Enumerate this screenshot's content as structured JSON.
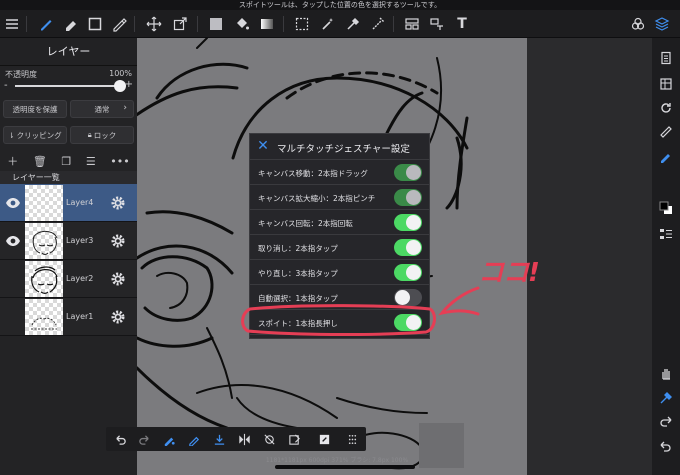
{
  "status_bar": {
    "message": "スポイトツールは、タップした位置の色を選択するツールです。"
  },
  "toolbar": {
    "icons": [
      "menu-icon",
      "brush-icon",
      "eraser-icon",
      "rectangle-icon",
      "pen-icon",
      "move-icon",
      "transform-icon",
      "color-fill-icon",
      "bucket-icon",
      "gradient-icon",
      "selection-icon",
      "magic-wand-icon",
      "eyedropper-icon",
      "lasso-icon",
      "layout-icon",
      "crop-icon",
      "text-icon",
      "materials-icon",
      "layers-icon"
    ],
    "text_icon_label": "T"
  },
  "layer_panel": {
    "title": "レイヤー",
    "opacity_label": "不透明度",
    "opacity_value": "100%",
    "opacity_fraction": 1.0,
    "minus_label": "-",
    "plus_label": "+",
    "protect_alpha_label": "透明度を保護",
    "blend_mode_label": "通常",
    "clipping_label": "クリッピング",
    "lock_label": "ロック",
    "list_header": "レイヤー一覧",
    "layers": [
      {
        "name": "Layer4",
        "selected": true,
        "visible": true
      },
      {
        "name": "Layer3",
        "selected": false,
        "visible": true
      },
      {
        "name": "Layer2",
        "selected": false,
        "visible": false
      },
      {
        "name": "Layer1",
        "selected": false,
        "visible": false
      }
    ]
  },
  "dialog": {
    "title": "マルチタッチジェスチャー設定",
    "options": [
      {
        "label": "キャンバス移動：2本指ドラッグ",
        "enabled": true,
        "dimmed": true
      },
      {
        "label": "キャンバス拡大縮小：2本指ピンチ",
        "enabled": true,
        "dimmed": true
      },
      {
        "label": "キャンバス回転：2本指回転",
        "enabled": true,
        "dimmed": false
      },
      {
        "label": "取り消し：2本指タップ",
        "enabled": true,
        "dimmed": false
      },
      {
        "label": "やり直し：3本指タップ",
        "enabled": true,
        "dimmed": false
      },
      {
        "label": "自動選択：1本指タップ",
        "enabled": false,
        "dimmed": false
      },
      {
        "label": "スポイト：1本指長押し",
        "enabled": true,
        "dimmed": false
      }
    ]
  },
  "annotation": {
    "text": "ココ!",
    "color": "#e53e55"
  },
  "footer": {
    "info": "1181*1181px 600dpi 371% ブラシ: 7.8px 100%"
  },
  "colors": {
    "accent": "#3f8ff0",
    "toggle_on": "#4cd964",
    "toggle_dimmed": "#3a8a48",
    "selected_layer": "#3d5a86"
  }
}
